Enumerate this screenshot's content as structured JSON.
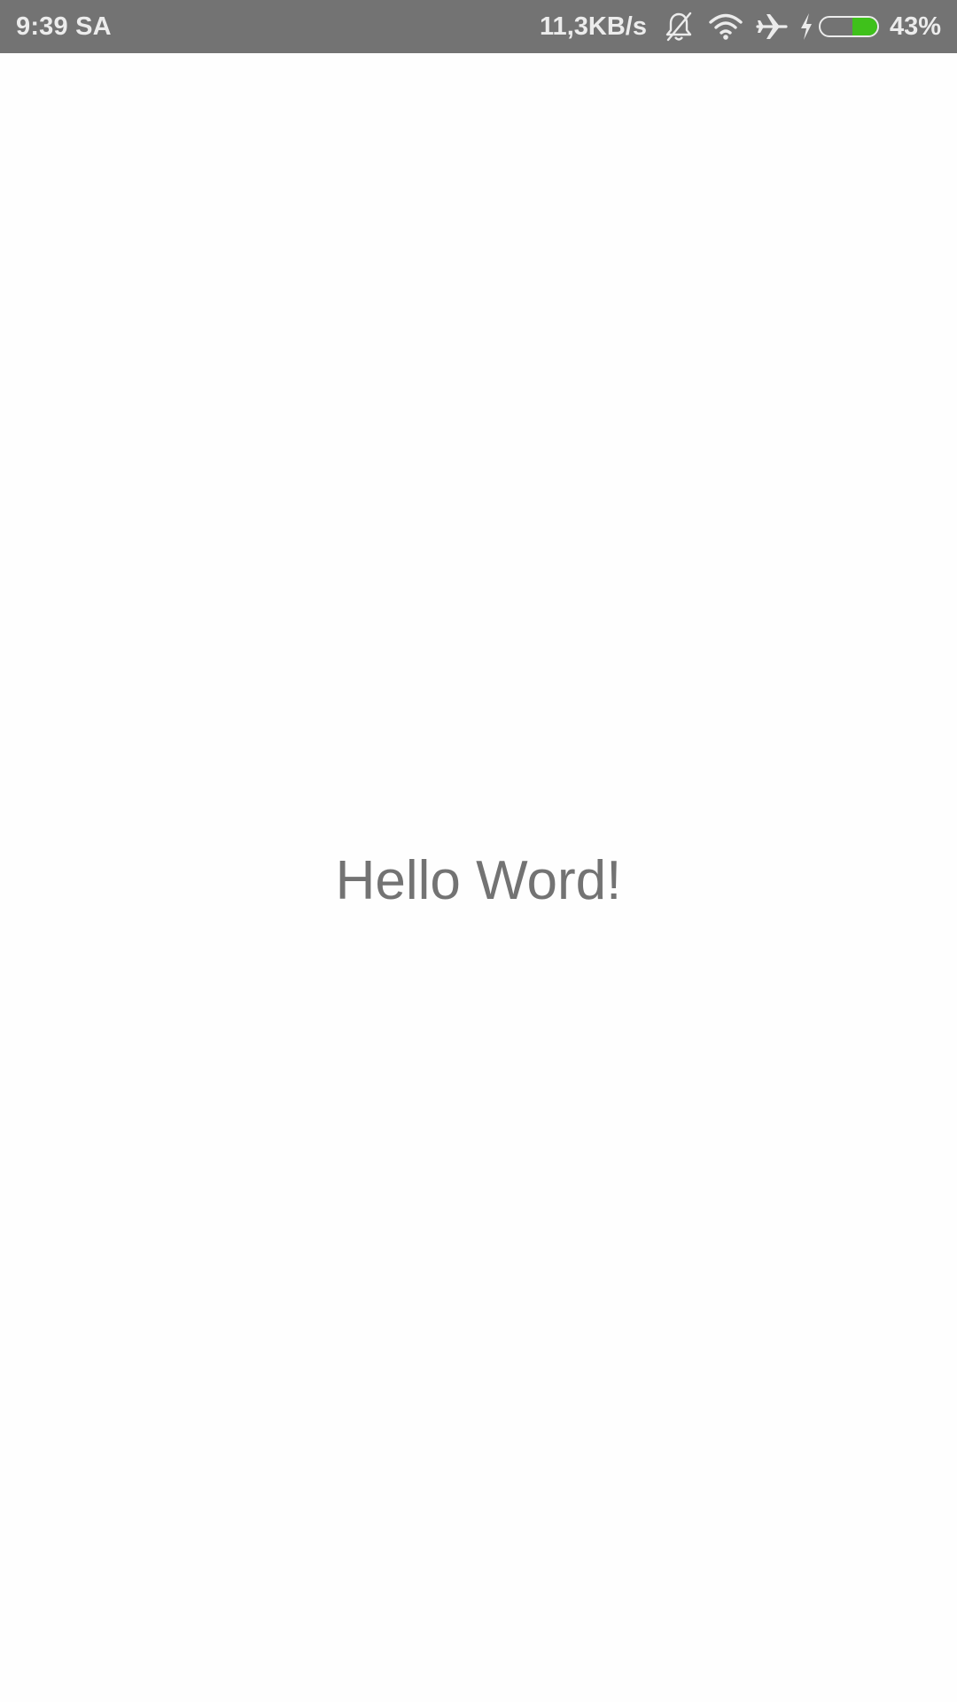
{
  "status_bar": {
    "time": "9:39 SA",
    "network_speed": "11,3KB/s",
    "icons": [
      "bell-off-icon",
      "wifi-icon",
      "airplane-mode-icon",
      "charging-bolt-icon",
      "battery-icon"
    ],
    "battery_level": 0.43,
    "battery_percent": "43%",
    "battery_color": "#3fc11b",
    "background_color": "#737373"
  },
  "main": {
    "text": "Hello Word!",
    "text_color": "#737373"
  }
}
